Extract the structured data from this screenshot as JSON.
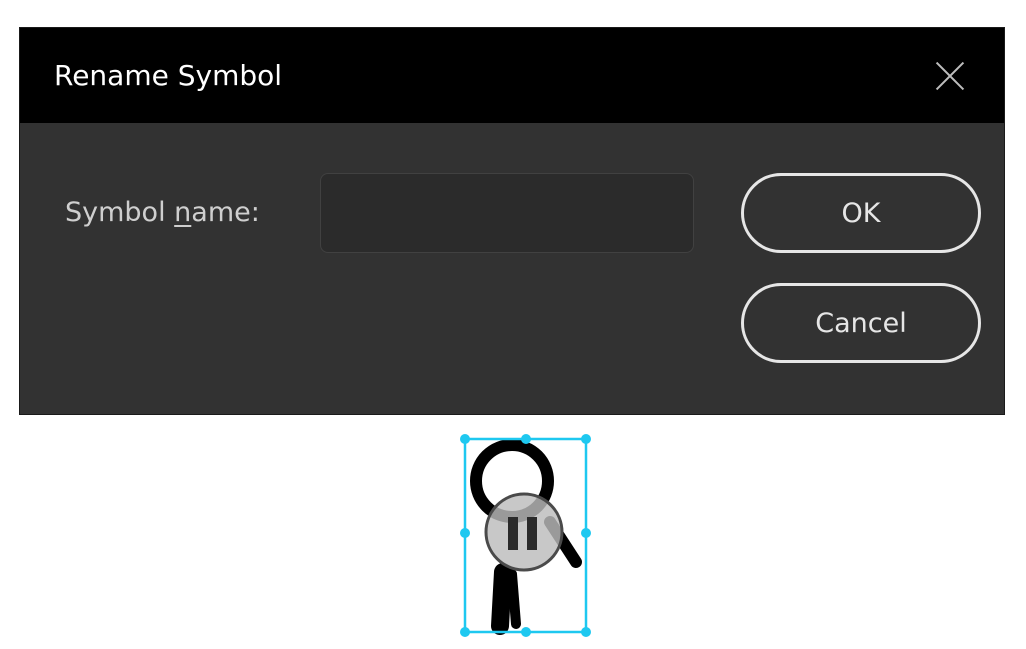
{
  "dialog": {
    "title": "Rename Symbol",
    "close_icon": "close-icon",
    "symbol_name_label_prefix": "Symbol ",
    "symbol_name_label_access_key": "n",
    "symbol_name_label_suffix": "ame:",
    "symbol_name_value": "",
    "ok_label": "OK",
    "cancel_label": "Cancel"
  },
  "stage": {
    "selection_color": "#1ec8f0",
    "playback_state_icon": "pause-icon"
  },
  "colors": {
    "dialog_bg": "#323232",
    "titlebar_bg": "#000000"
  }
}
